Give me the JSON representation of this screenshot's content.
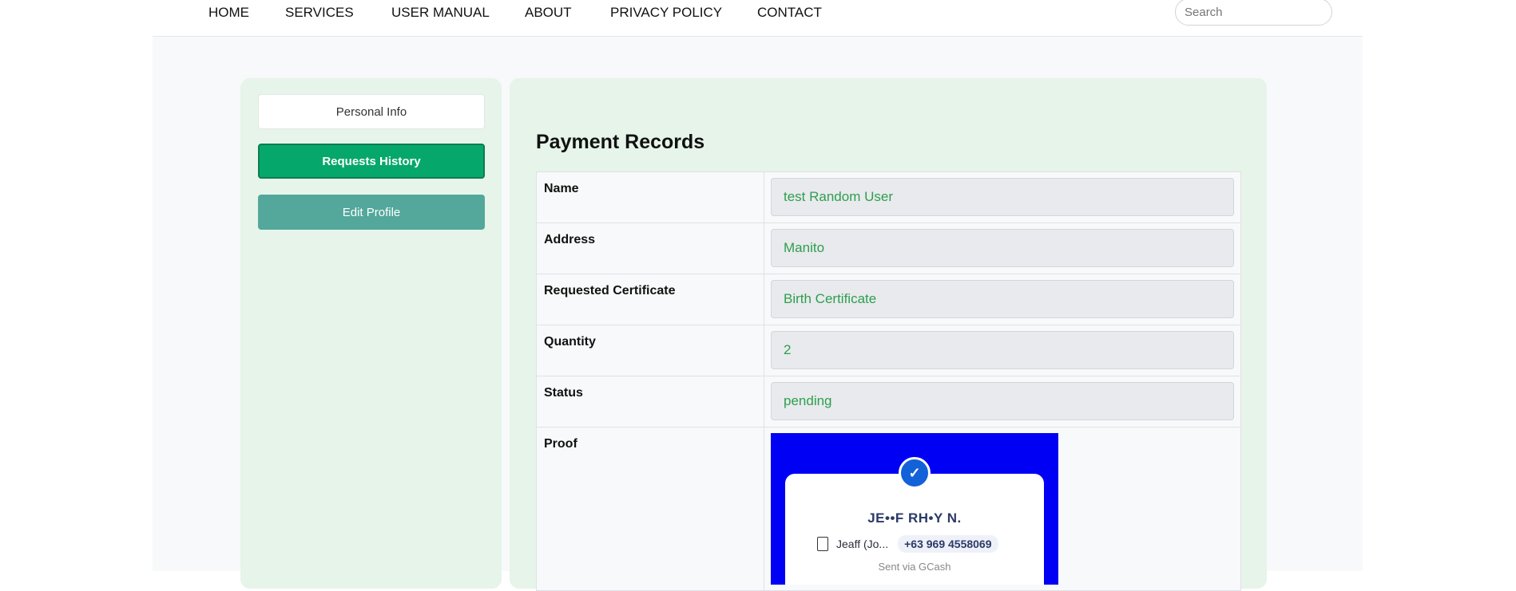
{
  "nav": {
    "items": [
      "HOME",
      "SERVICES",
      "USER MANUAL",
      "ABOUT",
      "PRIVACY POLICY",
      "CONTACT"
    ],
    "search_placeholder": "Search"
  },
  "sidebar": {
    "personal_info": "Personal Info",
    "requests_history": "Requests History",
    "edit_profile": "Edit Profile"
  },
  "main": {
    "title": "Payment Records",
    "rows": [
      {
        "label": "Name",
        "value": "test Random User"
      },
      {
        "label": "Address",
        "value": "Manito"
      },
      {
        "label": "Requested Certificate",
        "value": "Birth Certificate"
      },
      {
        "label": "Quantity",
        "value": "2"
      },
      {
        "label": "Status",
        "value": "pending"
      },
      {
        "label": "Proof"
      }
    ],
    "proof": {
      "recipient": "JE••F RH•Y N.",
      "account_name": "Jeaff (Jo...",
      "phone": "+63 969 4558069",
      "sent_via": "Sent via GCash"
    }
  },
  "colors": {
    "accent_green": "#05a86a",
    "teal": "#53a79b",
    "value_text": "#2e9e4f",
    "panel_bg": "#e6f4ea"
  }
}
